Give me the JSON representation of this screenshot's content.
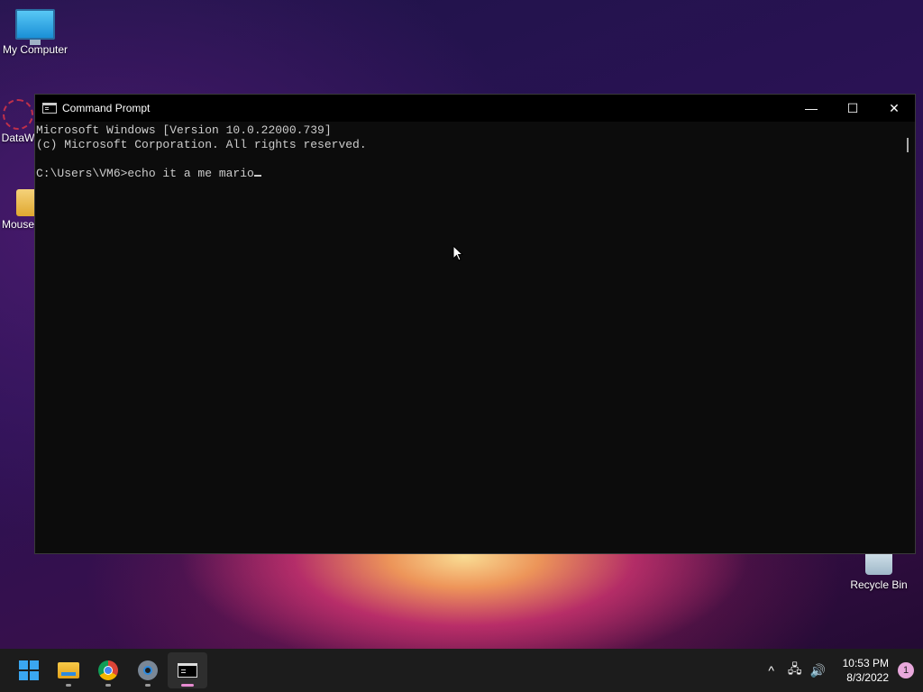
{
  "desktop": {
    "icons": [
      {
        "label": "My Computer"
      },
      {
        "label": "DataW"
      },
      {
        "label": "Mouse"
      },
      {
        "label": "Recycle Bin"
      }
    ]
  },
  "window": {
    "title": "Command Prompt",
    "controls": {
      "minimize": "—",
      "maximize": "☐",
      "close": "✕"
    },
    "lines": [
      "Microsoft Windows [Version 10.0.22000.739]",
      "(c) Microsoft Corporation. All rights reserved.",
      "",
      "C:\\Users\\VM6>echo it a me mario"
    ]
  },
  "taskbar": {
    "apps": [
      {
        "name": "start",
        "icon": "windows-logo-icon"
      },
      {
        "name": "file-explorer",
        "icon": "folder-icon"
      },
      {
        "name": "chrome",
        "icon": "chrome-icon"
      },
      {
        "name": "settings",
        "icon": "gear-icon"
      },
      {
        "name": "command-prompt",
        "icon": "terminal-icon",
        "active": true
      }
    ],
    "tray": {
      "chevron": "^",
      "network": "🖧",
      "volume": "🔊",
      "time": "10:53 PM",
      "date": "8/3/2022",
      "notifications": "1"
    }
  },
  "colors": {
    "accent": "#3aa6f0",
    "active_indicator": "#e68ad0",
    "terminal_bg": "#0c0c0c",
    "terminal_fg": "#cccccc"
  }
}
